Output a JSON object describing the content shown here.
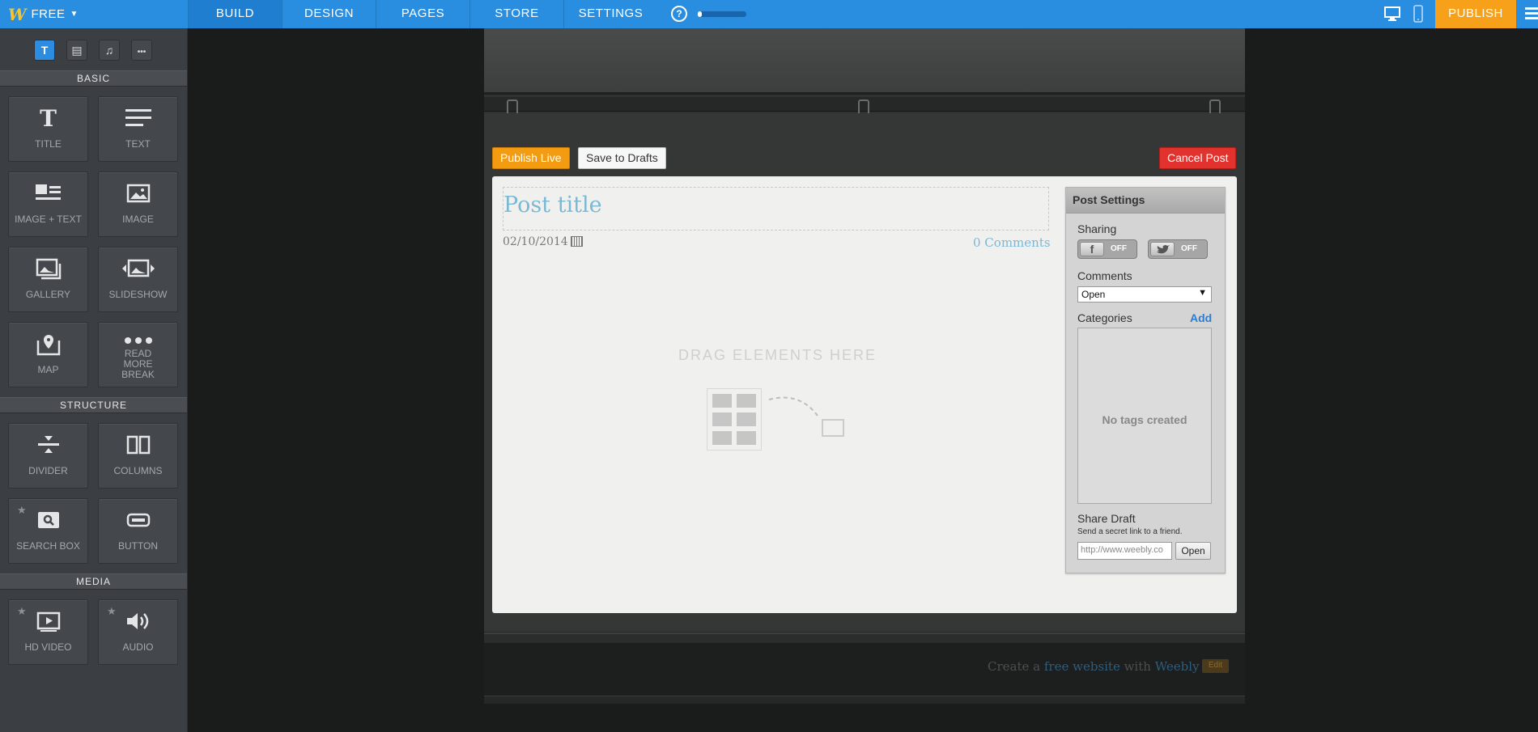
{
  "topbar": {
    "plan_label": "FREE",
    "logo_letter": "W",
    "nav": [
      "BUILD",
      "DESIGN",
      "PAGES",
      "STORE",
      "SETTINGS"
    ],
    "help_label": "?",
    "save_progress_percent": 8,
    "publish_label": "PUBLISH",
    "accent": "#2a8ee0",
    "publish_color": "#f7a11a"
  },
  "sidebar": {
    "tabs": [
      {
        "icon": "text-icon",
        "glyph": "T",
        "active": true
      },
      {
        "icon": "layout-icon",
        "glyph": "▤",
        "active": false
      },
      {
        "icon": "music-icon",
        "glyph": "♫",
        "active": false
      },
      {
        "icon": "more-icon",
        "glyph": "•••",
        "active": false
      }
    ],
    "sections": {
      "basic": "BASIC",
      "structure": "STRUCTURE",
      "media": "MEDIA"
    },
    "basic_items": [
      {
        "label": "TITLE",
        "icon": "title-icon"
      },
      {
        "label": "TEXT",
        "icon": "text-lines-icon"
      },
      {
        "label": "IMAGE + TEXT",
        "icon": "image-text-icon"
      },
      {
        "label": "IMAGE",
        "icon": "image-icon"
      },
      {
        "label": "GALLERY",
        "icon": "gallery-icon"
      },
      {
        "label": "SLIDESHOW",
        "icon": "slideshow-icon"
      },
      {
        "label": "MAP",
        "icon": "map-pin-icon"
      },
      {
        "label": "READ MORE BREAK",
        "icon": "ellipsis-icon"
      }
    ],
    "structure_items": [
      {
        "label": "DIVIDER",
        "icon": "divider-icon",
        "starred": false
      },
      {
        "label": "COLUMNS",
        "icon": "columns-icon",
        "starred": false
      },
      {
        "label": "SEARCH BOX",
        "icon": "search-icon",
        "starred": true
      },
      {
        "label": "BUTTON",
        "icon": "button-icon",
        "starred": false
      }
    ],
    "media_items": [
      {
        "label": "HD VIDEO",
        "icon": "video-icon",
        "starred": true
      },
      {
        "label": "AUDIO",
        "icon": "audio-icon",
        "starred": true
      }
    ]
  },
  "post_toolbar": {
    "publish_live": "Publish Live",
    "save_drafts": "Save to Drafts",
    "cancel": "Cancel Post"
  },
  "post": {
    "title_placeholder": "Post title",
    "date": "02/10/2014",
    "comments_link": "0 Comments",
    "drop_hint": "DRAG ELEMENTS HERE"
  },
  "post_settings": {
    "heading": "Post Settings",
    "sharing_label": "Sharing",
    "facebook_state": "OFF",
    "twitter_state": "OFF",
    "comments_label": "Comments",
    "comments_value": "Open",
    "categories_label": "Categories",
    "add_label": "Add",
    "no_tags": "No tags created",
    "share_draft_label": "Share Draft",
    "share_draft_hint": "Send a secret link to a friend.",
    "share_url": "http://www.weebly.co",
    "open_label": "Open"
  },
  "footer": {
    "text_pre": "Create a ",
    "text_link": "free website",
    "text_mid": " with ",
    "text_brand": "Weebly",
    "edit_badge": "Edit"
  }
}
